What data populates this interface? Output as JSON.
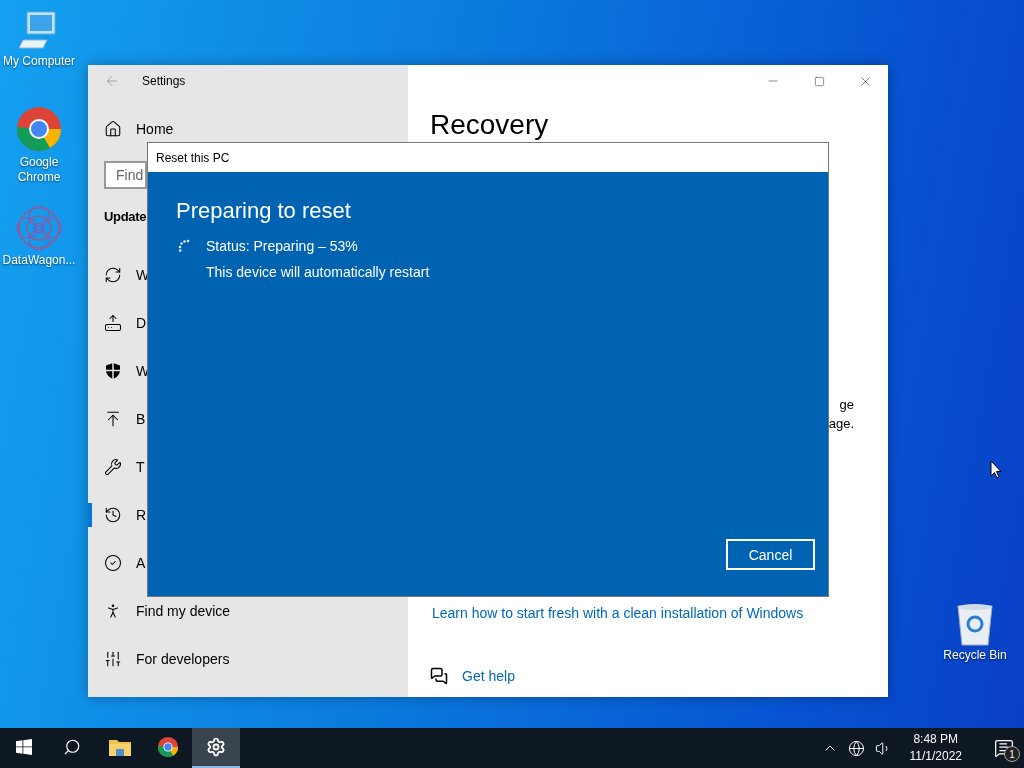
{
  "desktop_icons": [
    {
      "label": "My Computer",
      "kind": "computer"
    },
    {
      "label": "Google Chrome",
      "kind": "chrome"
    },
    {
      "label": "DataWagon...",
      "kind": "app"
    }
  ],
  "recycle_bin": {
    "label": "Recycle Bin"
  },
  "settings_window": {
    "title": "Settings",
    "home": "Home",
    "search_placeholder": "Find",
    "section": "Update",
    "items": [
      {
        "label": "W",
        "kind": "sync",
        "selected": false
      },
      {
        "label": "D",
        "kind": "delivery",
        "selected": false
      },
      {
        "label": "W",
        "kind": "shield",
        "selected": false
      },
      {
        "label": "B",
        "kind": "backup",
        "selected": false
      },
      {
        "label": "T",
        "kind": "wrench",
        "selected": false
      },
      {
        "label": "R",
        "kind": "recovery",
        "selected": true
      },
      {
        "label": "A",
        "kind": "check",
        "selected": false
      },
      {
        "label": "Find my device",
        "kind": "find",
        "selected": false
      },
      {
        "label": "For developers",
        "kind": "dev",
        "selected": false
      }
    ],
    "page_title": "Recovery",
    "text_fragments": [
      "ge",
      "age."
    ],
    "link": "Learn how to start fresh with a clean installation of Windows",
    "help": "Get help"
  },
  "dialog": {
    "title": "Reset this PC",
    "heading": "Preparing to reset",
    "status": "Status: Preparing – 53%",
    "note": "This device will automatically restart",
    "button": "Cancel"
  },
  "taskbar": {
    "apps": [
      {
        "kind": "start",
        "selected": false
      },
      {
        "kind": "search",
        "selected": false
      },
      {
        "kind": "folder",
        "selected": false
      },
      {
        "kind": "chrome",
        "selected": false
      },
      {
        "kind": "settings",
        "selected": true
      }
    ],
    "time": "8:48 PM",
    "date": "11/1/2022",
    "notifications": "1"
  }
}
